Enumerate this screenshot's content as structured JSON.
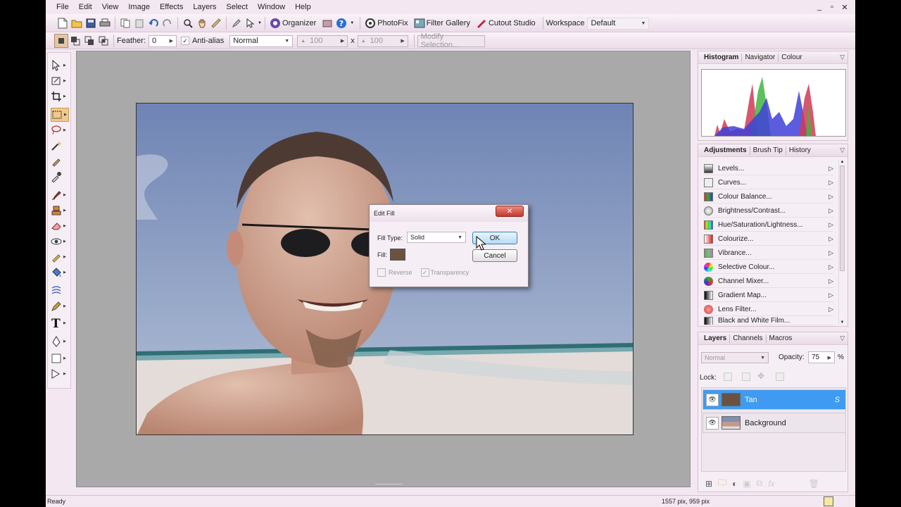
{
  "menubar": {
    "items": [
      "File",
      "Edit",
      "View",
      "Image",
      "Effects",
      "Layers",
      "Select",
      "Window",
      "Help"
    ],
    "window_controls": [
      "_",
      "▫",
      "✕"
    ]
  },
  "toolbar1": {
    "organizer_label": "Organizer",
    "photofix_label": "PhotoFix",
    "filter_gallery_label": "Filter Gallery",
    "cutout_studio_label": "Cutout Studio",
    "workspace_label": "Workspace",
    "workspace_value": "Default"
  },
  "toolbar2": {
    "feather_label": "Feather:",
    "feather_value": "0",
    "antialias_label": "Anti-alias",
    "mode_value": "Normal",
    "width_value": "100",
    "x_label": "x",
    "height_value": "100",
    "modify_selection_label": "Modify Selection..."
  },
  "tools": [
    "move-tool",
    "transform-tool",
    "crop-tool",
    "rect-select-tool",
    "lasso-tool",
    "wand-tool",
    "brush-select-tool",
    "eyedropper-tool",
    "paintbrush-tool",
    "clone-tool",
    "eraser-tool",
    "redeye-tool",
    "smudge-tool",
    "fill-tool",
    "warp-tool",
    "pen-tool",
    "text-tool",
    "path-tool",
    "shape-tool",
    "select-shape-tool"
  ],
  "dialog": {
    "title": "Edit Fill",
    "fill_type_label": "Fill Type:",
    "fill_type_value": "Solid",
    "fill_label": "Fill:",
    "fill_color": "#6b5240",
    "ok_label": "OK",
    "cancel_label": "Cancel",
    "reverse_label": "Reverse",
    "transparency_label": "Transparency"
  },
  "histogram_panel": {
    "tabs": [
      "Histogram",
      "Navigator",
      "Colour"
    ]
  },
  "adjustments_panel": {
    "tabs": [
      "Adjustments",
      "Brush Tip",
      "History"
    ],
    "items": [
      {
        "label": "Levels...",
        "icon": "levels-icon",
        "color": "#333"
      },
      {
        "label": "Curves...",
        "icon": "curves-icon",
        "color": "#888"
      },
      {
        "label": "Colour Balance...",
        "icon": "colour-balance-icon",
        "color": "#c44"
      },
      {
        "label": "Brightness/Contrast...",
        "icon": "brightness-icon",
        "color": "#999"
      },
      {
        "label": "Hue/Saturation/Lightness...",
        "icon": "hue-icon",
        "color": "#4a4"
      },
      {
        "label": "Colourize...",
        "icon": "colourize-icon",
        "color": "#d33"
      },
      {
        "label": "Vibrance...",
        "icon": "vibrance-icon",
        "color": "#6a6"
      },
      {
        "label": "Selective Colour...",
        "icon": "selective-colour-icon",
        "color": "#e63"
      },
      {
        "label": "Channel Mixer...",
        "icon": "channel-mixer-icon",
        "color": "#3a3"
      },
      {
        "label": "Gradient Map...",
        "icon": "gradient-map-icon",
        "color": "#555"
      },
      {
        "label": "Lens Filter...",
        "icon": "lens-filter-icon",
        "color": "#d55"
      },
      {
        "label": "Black and White Film...",
        "icon": "bw-film-icon",
        "color": "#444"
      }
    ]
  },
  "layers_panel": {
    "tabs": [
      "Layers",
      "Channels",
      "Macros"
    ],
    "blend_mode": "Normal",
    "opacity_label": "Opacity:",
    "opacity_value": "75",
    "percent": "%",
    "lock_label": "Lock:",
    "layers": [
      {
        "name": "Tan",
        "badge": "S",
        "selected": true,
        "thumb_color": "#6b5240"
      },
      {
        "name": "Background",
        "badge": "",
        "selected": false,
        "thumb_color": "#8b7a74"
      }
    ]
  },
  "statusbar": {
    "status": "Ready",
    "dimensions": "1557 pix, 959 pix"
  },
  "colors": {
    "app_bg": "#f3e8f1",
    "canvas_bg": "#a9a9a9",
    "selection_blue": "#3f9bf1",
    "close_red": "#d9403b"
  }
}
